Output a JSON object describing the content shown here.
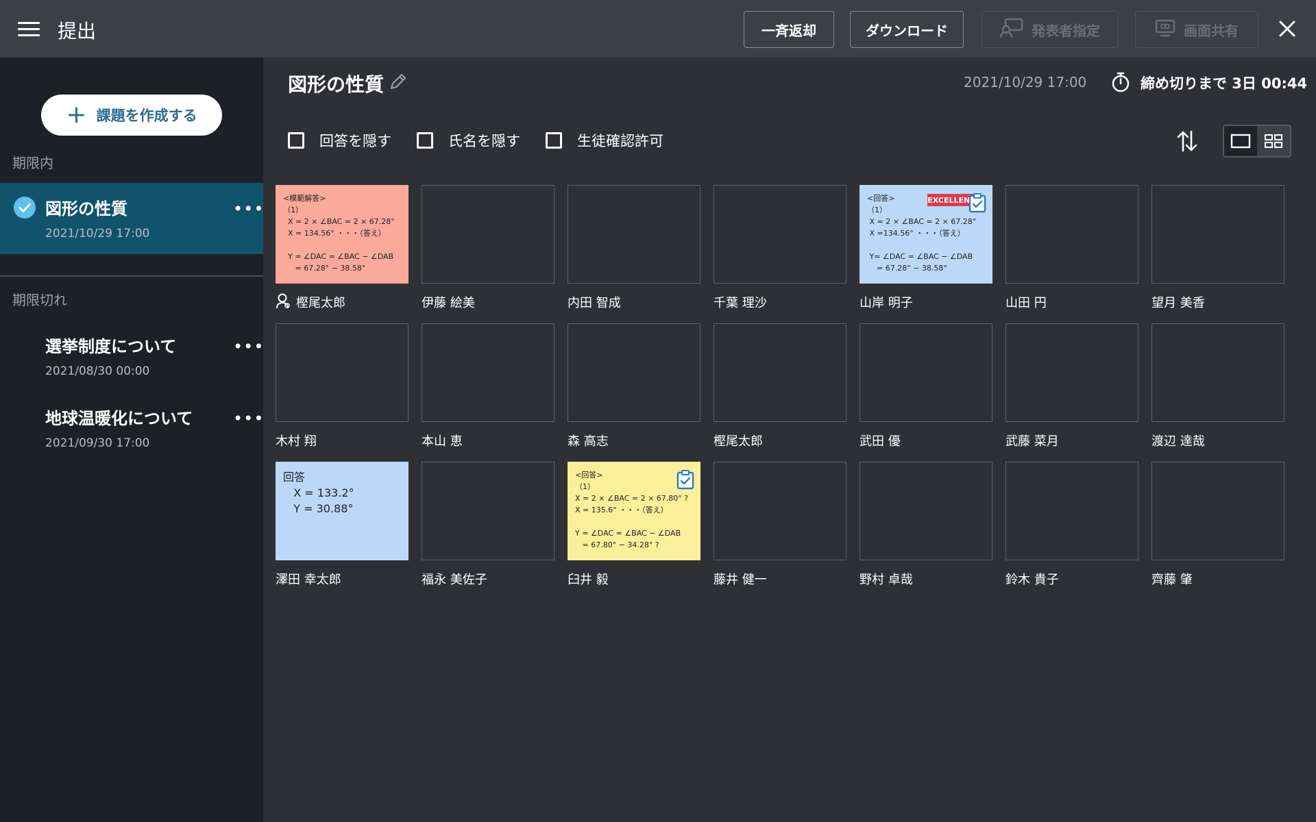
{
  "header": {
    "title": "提出",
    "buttons": {
      "return_all": "一斉返却",
      "download": "ダウンロード",
      "presenter": "発表者指定",
      "screen_share": "画面共有"
    }
  },
  "sidebar": {
    "create_label": "課題を作成する",
    "in_term_label": "期限内",
    "expired_label": "期限切れ",
    "active": {
      "title": "図形の性質",
      "date": "2021/10/29 17:00",
      "more": "•••"
    },
    "expired": [
      {
        "title": "選挙制度について",
        "date": "2021/08/30 00:00",
        "more": "•••"
      },
      {
        "title": "地球温暖化について",
        "date": "2021/09/30 17:00",
        "more": "•••"
      }
    ]
  },
  "main": {
    "title": "図形の性質",
    "due_date": "2021/10/29 17:00",
    "deadline": "締め切りまで 3日 00:44",
    "options": {
      "hide_answers": "回答を隠す",
      "hide_names": "氏名を隠す",
      "student_confirm": "生徒確認許可"
    }
  },
  "students": [
    {
      "name": "樫尾太郎",
      "color": "pink",
      "answer": "<模範解答>\n（1）\n  X = 2 × ∠BAC = 2 × 67.28°\n  X = 134.56° ・・・（答え）\n\n  Y = ∠DAC = ∠BAC − ∠DAB\n     = 67.28° − 38.58°"
    },
    {
      "name": "伊藤 絵美"
    },
    {
      "name": "内田 智成"
    },
    {
      "name": "千葉 理沙"
    },
    {
      "name": "山岸 明子",
      "color": "blue",
      "stamp": "EXCELLENT",
      "answer": "<回答>\n（1）\n X = 2 × ∠BAC = 2 × 67.28°\n X =134.56° ・・・（答え）\n\n Y= ∠DAC = ∠BAC − ∠DAB\n    = 67.28° − 38.58°"
    },
    {
      "name": "山田 円"
    },
    {
      "name": "望月 美香"
    },
    {
      "name": "木村 翔"
    },
    {
      "name": "本山 恵"
    },
    {
      "name": "森 高志"
    },
    {
      "name": "樫尾太郎"
    },
    {
      "name": "武田 優"
    },
    {
      "name": "武藤 菜月"
    },
    {
      "name": "渡辺 達哉"
    },
    {
      "name": "澤田 幸太郎",
      "color": "blue",
      "answer": "回答\n   X = 133.2°\n   Y = 30.88°"
    },
    {
      "name": "福永 美佐子"
    },
    {
      "name": "臼井 毅",
      "color": "yellow",
      "answer": "<回答>\n（1）\nX = 2 × ∠BAC = 2 × 67.80° ?\nX = 135.6° ・・・（答え）\n\nY = ∠DAC = ∠BAC − ∠DAB\n   = 67.80° − 34.28° ?"
    },
    {
      "name": "藤井 健一"
    },
    {
      "name": "野村 卓哉"
    },
    {
      "name": "鈴木 貴子"
    },
    {
      "name": "齊藤 肇"
    }
  ],
  "colors": {
    "accent": "#12536c",
    "check": "#5ec3ec",
    "create_text": "#2b6d90"
  }
}
